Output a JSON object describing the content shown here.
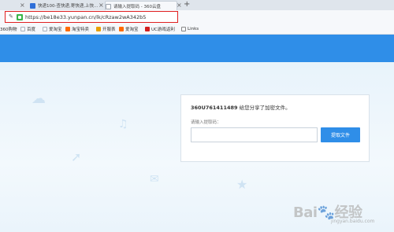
{
  "browser": {
    "tabs": [
      {
        "label": "快递100-查快递,寄快递,上快…",
        "active": false,
        "favicon_color": "#2f6fd8"
      },
      {
        "label": "请输入提取码 - 360云盘",
        "active": true,
        "favicon_color": "#9aa3ad"
      }
    ],
    "address_url": "https://be18e33.yunpan.cn/lk/cRzaw2wA342b5",
    "bookmarks": [
      {
        "label": "360购物",
        "icon_color": "#3b8fd9"
      },
      {
        "label": "百度",
        "icon_color": "#2f6fd8"
      },
      {
        "label": "爱淘宝",
        "icon_color": "#ff6a00"
      },
      {
        "label": "淘宝特卖",
        "icon_color": "#ff6a00"
      },
      {
        "label": "开服表",
        "icon_color": "#e8a000"
      },
      {
        "label": "爱淘宝",
        "icon_color": "#ff6a00"
      },
      {
        "label": "UC游戏返利",
        "icon_color": "#d21f1f"
      },
      {
        "label": "Links",
        "icon_color": "#999999"
      }
    ]
  },
  "card": {
    "share_code": "360U761411489",
    "share_text": "给您分享了加密文件。",
    "prompt_label": "请输入提取码：",
    "input_value": "",
    "button_label": "提取文件"
  },
  "watermark": {
    "logo_text": "Baidu经验",
    "sub_text": "jingyan.baidu.com"
  },
  "colors": {
    "header": "#2f8ee8",
    "button": "#2f8ee8",
    "address_highlight": "#e02020"
  }
}
